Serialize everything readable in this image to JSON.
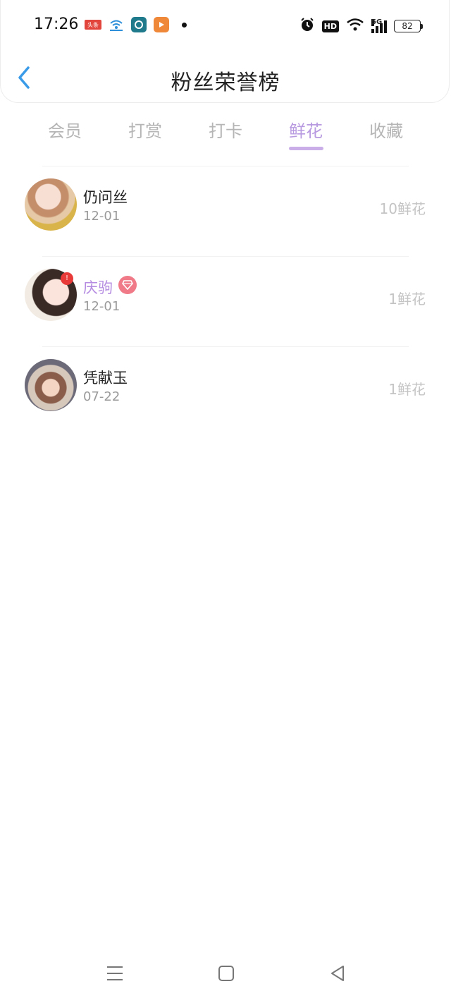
{
  "status_bar": {
    "time": "17:26",
    "notification_icons": [
      "toutiao-icon",
      "wifi-app-icon",
      "teal-app-icon",
      "video-app-icon"
    ],
    "notification_label": "头条",
    "network_label": "5G",
    "hd_label": "HD",
    "battery": "82"
  },
  "header": {
    "title": "粉丝荣誉榜"
  },
  "tabs": [
    {
      "label": "会员",
      "active": false
    },
    {
      "label": "打赏",
      "active": false
    },
    {
      "label": "打卡",
      "active": false
    },
    {
      "label": "鲜花",
      "active": true
    },
    {
      "label": "收藏",
      "active": false
    }
  ],
  "colors": {
    "accent": "#b89ae0",
    "inactive_tab": "#b5b5b5",
    "back_arrow": "#3a9be8",
    "vip_badge": "#f07a87"
  },
  "list": [
    {
      "name": "仍问丝",
      "date": "12-01",
      "amount": "10鲜花",
      "vip": false
    },
    {
      "name": "庆驹",
      "date": "12-01",
      "amount": "1鲜花",
      "vip": true
    },
    {
      "name": "凭献玉",
      "date": "07-22",
      "amount": "1鲜花",
      "vip": false
    }
  ]
}
